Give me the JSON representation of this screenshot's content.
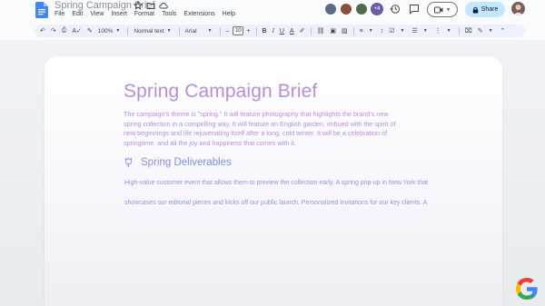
{
  "doc": {
    "title": "Spring Campaign Brief"
  },
  "menu": [
    "File",
    "Edit",
    "View",
    "Insert",
    "Format",
    "Tools",
    "Extensions",
    "Help"
  ],
  "collaborators": {
    "extra_count": "+4"
  },
  "share": {
    "label": "Share"
  },
  "toolbar": {
    "zoom": "100%",
    "style": "Normal text",
    "font": "Arial",
    "font_size": "10",
    "minus": "–",
    "plus": "+"
  },
  "content": {
    "heading": "Spring Campaign Brief",
    "paragraph_lines": [
      "The campaign's theme is \"spring.\" It will feature photography that highlights the brand's new",
      "spring collection in a compelling way. It will feature an English garden, imbued with the spirit of",
      "new beginnings and life rejuvenating itself after a long, cold winter. It will be a celebration of",
      "springtime, and all the joy and happiness that comes with it."
    ],
    "subheading_word1": "Spring",
    "subheading_word2": "Deliverables",
    "line1": "High-value customer event that allows them to preview the collection early. A spring pop-up in New York that",
    "line2": "showcases our editorial pieces and kicks off our public launch. Personalized invitations for our key clients. A"
  },
  "colors": {
    "heading": "#b58fd8",
    "body": "#b590d9",
    "subtext": "#8f98d6",
    "share_bg": "#c2e7ff",
    "toolbar_bg": "#edf2fa"
  }
}
